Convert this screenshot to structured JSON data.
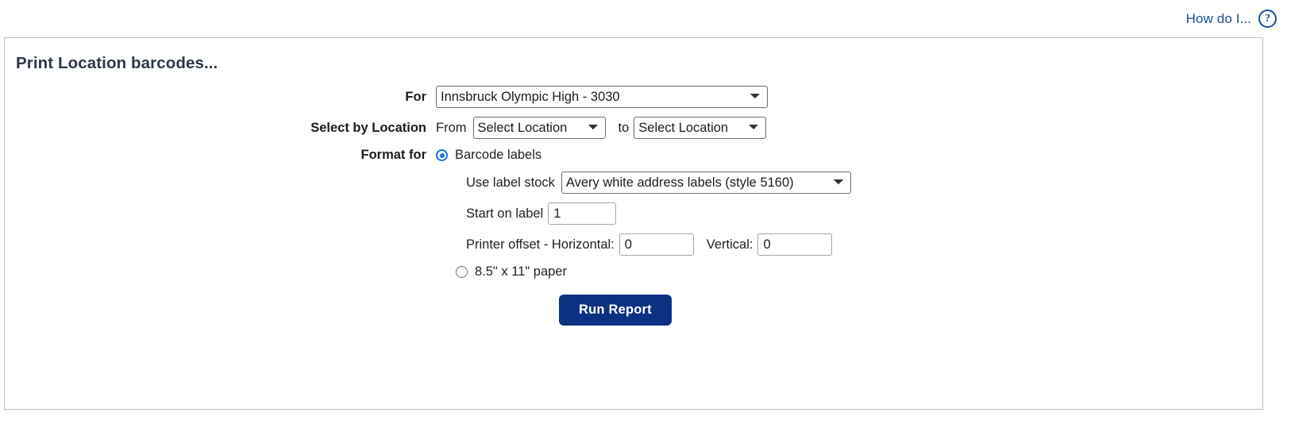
{
  "help": {
    "label": "How do I...",
    "icon_glyph": "?",
    "link_color": "#1a4f96"
  },
  "panel": {
    "title": "Print Location barcodes...",
    "border_color": "#bfbfbf"
  },
  "form": {
    "for": {
      "label": "For",
      "selected": "Innsbruck Olympic High - 3030"
    },
    "select_by_location": {
      "label": "Select by Location",
      "from_word": "From",
      "from_selected": "Select Location",
      "to_word": "to",
      "to_selected": "Select Location"
    },
    "format_for": {
      "label": "Format for",
      "barcode_option": {
        "text": "Barcode labels",
        "selected": true,
        "accent": "#1273e6"
      },
      "label_stock": {
        "label": "Use label stock",
        "selected": "Avery white address labels (style 5160)"
      },
      "start_on_label": {
        "label": "Start on label",
        "value": "1"
      },
      "printer_offset": {
        "label": "Printer offset - Horizontal:",
        "horizontal_value": "0",
        "vertical_label": "Vertical:",
        "vertical_value": "0"
      },
      "paper_option": {
        "text": "8.5\" x 11\" paper",
        "selected": false
      }
    }
  },
  "actions": {
    "run_report": "Run Report",
    "run_report_color": "#0c3183"
  }
}
